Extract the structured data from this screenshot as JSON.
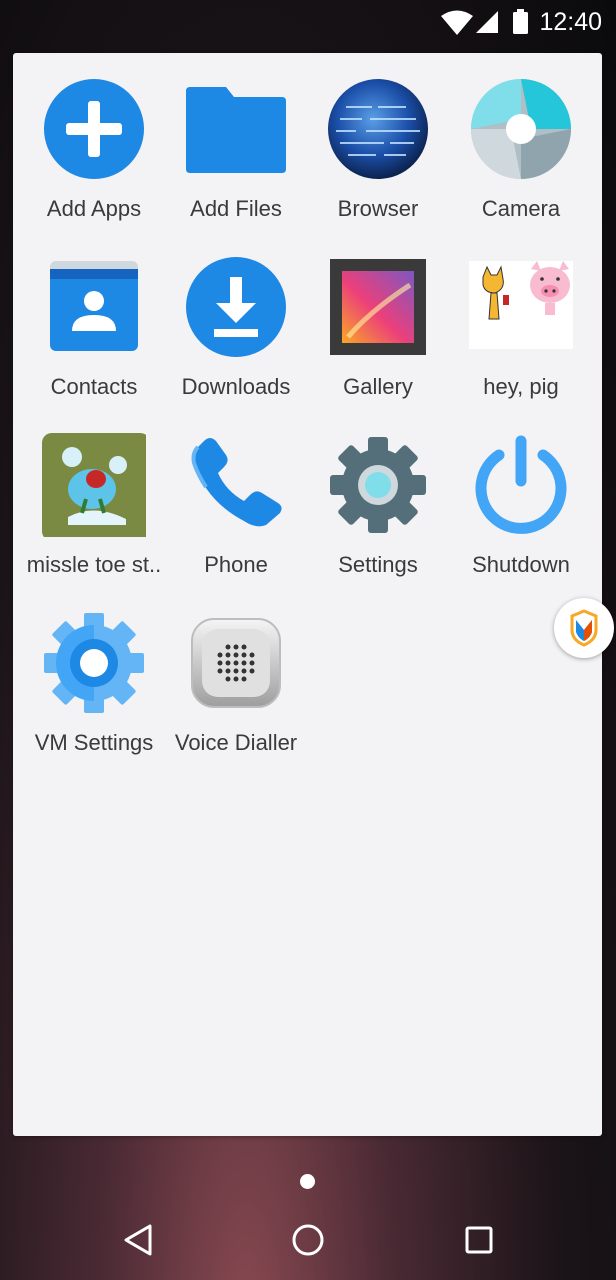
{
  "status_bar": {
    "time": "12:40",
    "icons": [
      "wifi-icon",
      "cellular-signal-icon",
      "battery-icon"
    ]
  },
  "apps": [
    {
      "label": "Add Apps",
      "icon": "add-icon"
    },
    {
      "label": "Add Files",
      "icon": "folder-icon"
    },
    {
      "label": "Browser",
      "icon": "globe-icon"
    },
    {
      "label": "Camera",
      "icon": "camera-shutter-icon"
    },
    {
      "label": "Contacts",
      "icon": "contacts-icon"
    },
    {
      "label": "Downloads",
      "icon": "download-icon"
    },
    {
      "label": "Gallery",
      "icon": "gallery-icon"
    },
    {
      "label": "hey, pig",
      "icon": "hey-pig-app-icon"
    },
    {
      "label": "missle toe st..",
      "icon": "missle-toe-game-icon"
    },
    {
      "label": "Phone",
      "icon": "phone-icon"
    },
    {
      "label": "Settings",
      "icon": "settings-gear-icon"
    },
    {
      "label": "Shutdown",
      "icon": "power-icon"
    },
    {
      "label": "VM Settings",
      "icon": "vm-settings-gear-icon"
    },
    {
      "label": "Voice Dialler",
      "icon": "voice-dialler-icon"
    }
  ],
  "navigation": {
    "buttons": [
      "back-icon",
      "home-icon",
      "recents-icon"
    ]
  },
  "colors": {
    "drawer_background": "#f3f2f5",
    "label_text": "#3a3a3a",
    "accent_blue": "#1e88e5"
  }
}
